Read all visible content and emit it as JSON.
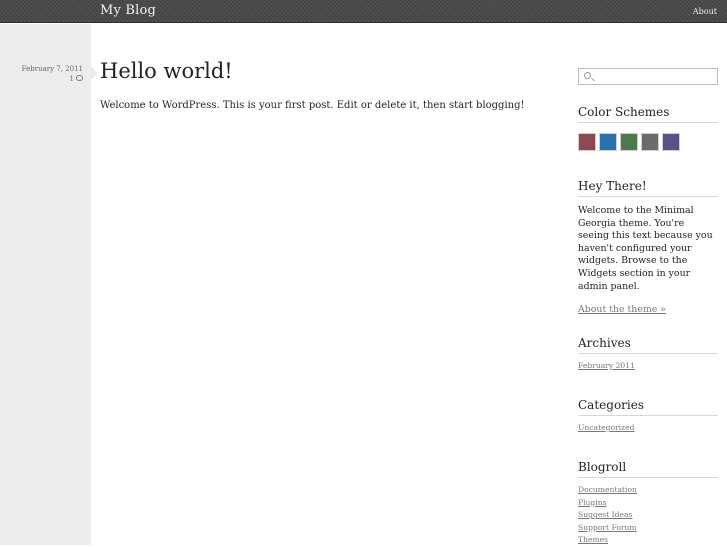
{
  "header": {
    "site_title": "My Blog",
    "nav": {
      "about": "About"
    }
  },
  "post": {
    "date": "February 7, 2011",
    "comments": "1",
    "title": "Hello world!",
    "body": "Welcome to WordPress. This is your first post. Edit or delete it, then start blogging!"
  },
  "sidebar": {
    "search": {
      "value": "",
      "placeholder": ""
    },
    "color_schemes": {
      "title": "Color Schemes",
      "swatches": [
        "#8a4a50",
        "#2a6fb0",
        "#4e7a4a",
        "#6b6b6b",
        "#5a5088"
      ]
    },
    "hey_there": {
      "title": "Hey There!",
      "text": "Welcome to the Minimal Georgia theme. You're seeing this text because you haven't configured your widgets. Browse to the Widgets section in your admin panel.",
      "link": "About the theme »"
    },
    "archives": {
      "title": "Archives",
      "items": [
        "February 2011"
      ]
    },
    "categories": {
      "title": "Categories",
      "items": [
        "Uncategorized"
      ]
    },
    "blogroll": {
      "title": "Blogroll",
      "items": [
        "Documentation",
        "Plugins",
        "Suggest Ideas",
        "Support Forum",
        "Themes"
      ]
    }
  }
}
